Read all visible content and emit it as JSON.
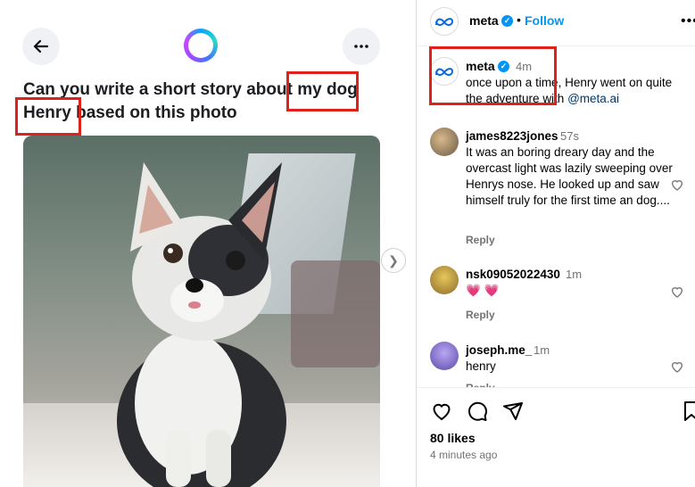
{
  "left": {
    "prompt": "Can you write a short story about my dog Henry based on this photo"
  },
  "header": {
    "username": "meta",
    "follow_label": "Follow",
    "separator": "•"
  },
  "caption": {
    "username": "meta",
    "time": "4m",
    "text": "once upon a time, Henry went on quite the adventure with ",
    "mention": "@meta.ai"
  },
  "comments": [
    {
      "username": "james8223jones",
      "time": "57s",
      "text": "It was an boring dreary day and the overcast light was lazily sweeping over Henrys nose. He looked up and saw himself truly for the first time an dog....",
      "reply": "Reply"
    },
    {
      "username": "nsk09052022430",
      "time": "1m",
      "text": "💗 💗",
      "reply": "Reply"
    },
    {
      "username": "joseph.me_",
      "time": "1m",
      "text": "henry",
      "reply": "Reply"
    }
  ],
  "footer": {
    "likes": "80 likes",
    "ago": "4 minutes ago"
  },
  "colors": {
    "highlight": "#e0201b",
    "link": "#0095f6",
    "verified": "#0095f6"
  }
}
